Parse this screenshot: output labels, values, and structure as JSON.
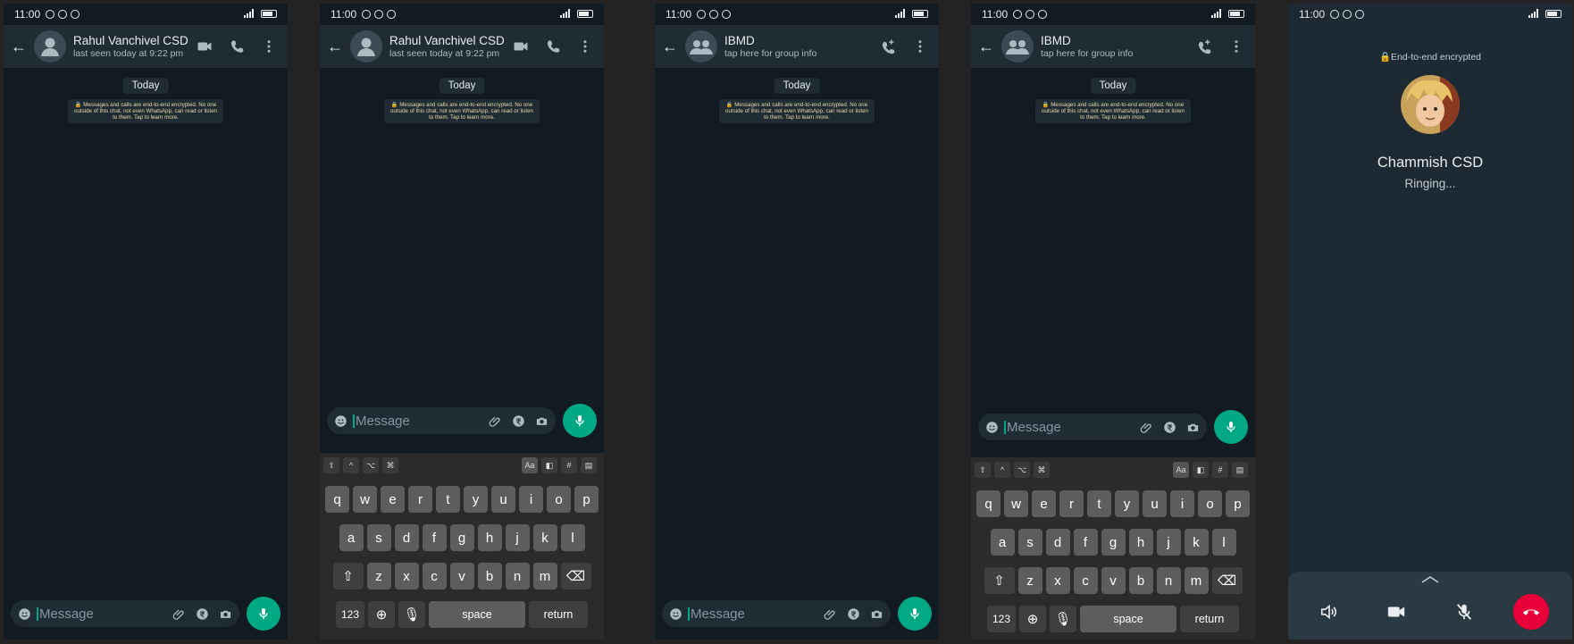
{
  "status": {
    "time": "11:00"
  },
  "screens": [
    {
      "name": "Rahul Vanchivel CSD",
      "sub": "last seen today at 9:22 pm"
    },
    {
      "name": "Rahul Vanchivel CSD",
      "sub": "last seen today at 9:22 pm"
    },
    {
      "name": "IBMD",
      "sub": "tap here for group info"
    },
    {
      "name": "IBMD",
      "sub": "tap here for group info"
    }
  ],
  "chat": {
    "today": "Today",
    "encryption_notice": "🔒 Messages and calls are end-to-end encrypted. No one outside of this chat, not even WhatsApp, can read or listen to them. Tap to learn more.",
    "placeholder": "Message"
  },
  "keyboard": {
    "tools_left": [
      "⇧",
      "^",
      "⌥",
      "⌘"
    ],
    "tools_right": [
      "Aa",
      "◧",
      "#",
      "▤"
    ],
    "row1": [
      "q",
      "w",
      "e",
      "r",
      "t",
      "y",
      "u",
      "i",
      "o",
      "p"
    ],
    "row2": [
      "a",
      "s",
      "d",
      "f",
      "g",
      "h",
      "j",
      "k",
      "l"
    ],
    "row3": [
      "z",
      "x",
      "c",
      "v",
      "b",
      "n",
      "m"
    ],
    "num_label": "123",
    "space_label": "space",
    "return_label": "return"
  },
  "call": {
    "encrypted": "🔒End-to-end encrypted",
    "name": "Chammish CSD",
    "status": "Ringing..."
  },
  "colors": {
    "accent": "#00a884",
    "header": "#1f2c34",
    "background": "#121b22",
    "end_call": "#ea0038"
  }
}
